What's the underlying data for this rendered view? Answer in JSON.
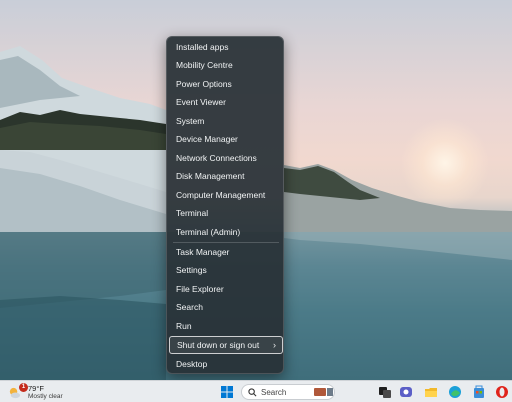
{
  "context_menu": {
    "items": [
      {
        "label": "Installed apps"
      },
      {
        "label": "Mobility Centre"
      },
      {
        "label": "Power Options"
      },
      {
        "label": "Event Viewer"
      },
      {
        "label": "System"
      },
      {
        "label": "Device Manager"
      },
      {
        "label": "Network Connections"
      },
      {
        "label": "Disk Management"
      },
      {
        "label": "Computer Management"
      },
      {
        "label": "Terminal"
      },
      {
        "label": "Terminal (Admin)"
      },
      {
        "label": "Task Manager"
      },
      {
        "label": "Settings"
      },
      {
        "label": "File Explorer"
      },
      {
        "label": "Search"
      },
      {
        "label": "Run"
      },
      {
        "label": "Shut down or sign out",
        "submenu": true,
        "submenu_icon": "chevron-right-icon"
      },
      {
        "label": "Desktop"
      }
    ]
  },
  "taskbar": {
    "weather": {
      "temperature": "79°F",
      "condition": "Mostly clear",
      "badge": "1",
      "icon": "weather-moon-cloud-icon"
    },
    "search": {
      "placeholder": "Search",
      "icon": "search-icon"
    },
    "icons": [
      "start-icon",
      "search-icon",
      "widgets-icon",
      "task-view-icon",
      "meet-icon",
      "file-explorer-icon",
      "edge-icon",
      "store-icon",
      "opera-icon"
    ]
  },
  "colors": {
    "menu_bg": "#283036",
    "menu_text": "#f2f4f5",
    "taskbar_bg": "#e9ecef",
    "accent": "#0078d4"
  }
}
